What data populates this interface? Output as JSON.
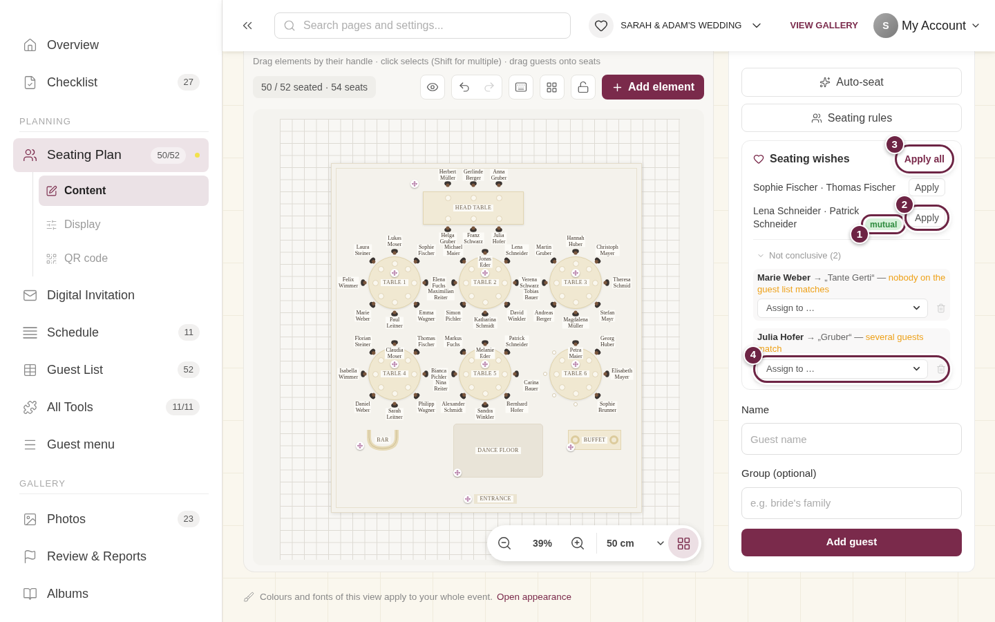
{
  "sidebar": {
    "groups": [
      {
        "items": [
          {
            "label": "Overview",
            "selected": false
          },
          {
            "label": "Checklist",
            "count": "27",
            "selected": false
          }
        ]
      },
      {
        "title": "PLANNING",
        "items": [
          {
            "label": "Seating Plan",
            "count": "50/52",
            "color": "#f2e14c",
            "selected": true,
            "children": [
              {
                "label": "Content",
                "selected": true
              },
              {
                "label": "Display",
                "selected": false
              },
              {
                "label": "QR code",
                "selected": false
              }
            ]
          },
          {
            "label": "Digital Invitation",
            "selected": false
          },
          {
            "label": "Schedule",
            "count": "11",
            "selected": false
          },
          {
            "label": "Guest List",
            "count": "52",
            "selected": false
          },
          {
            "label": "All Tools",
            "count": "11/11",
            "selected": false
          },
          {
            "label": "Guest menu",
            "selected": false
          }
        ]
      },
      {
        "title": "GALLERY",
        "items": [
          {
            "label": "Photos",
            "count": "23",
            "selected": false
          },
          {
            "label": "Review & Reports",
            "selected": false
          },
          {
            "label": "Albums",
            "selected": false
          }
        ]
      }
    ]
  },
  "topbar": {
    "search": {
      "placeholder": "Search pages and settings..."
    },
    "event": {
      "name": "SARAH & ADAM'S WEDDING"
    },
    "gallery_link": "VIEW GALLERY",
    "account": {
      "initial": "S",
      "label": "My Account"
    }
  },
  "seating_plan": {
    "hint": "Drag elements by their handle · click selects (Shift for multiple) · drag guests onto seats",
    "stats": "50 / 52 seated · 54 seats",
    "undo": {
      "disabled": false
    },
    "redo": {
      "disabled": true
    },
    "add_button": "Add element",
    "head_table": {
      "label": "HEAD TABLE",
      "top_seats": [
        {
          "occupied": true,
          "guest": "Herbert Müller"
        },
        {
          "occupied": true,
          "guest": "Gerlinde Berger"
        },
        {
          "occupied": true,
          "guest": "Anna Gruber"
        }
      ],
      "bottom_seats": [
        {
          "occupied": true,
          "guest": "Helga Gruber"
        },
        {
          "occupied": true,
          "guest": "Franz Schwarz"
        },
        {
          "occupied": true,
          "guest": "Julia Hofer"
        }
      ]
    },
    "tables": [
      {
        "label": "TABLE 1",
        "seats": [
          {
            "occupied": true,
            "guest": "Lukas Moser"
          },
          {
            "occupied": true,
            "guest": "Sophie Fischer"
          },
          {
            "occupied": true,
            "guest": "Maximilian Reiter"
          },
          {
            "occupied": true,
            "guest": "Emma Wagner"
          },
          {
            "occupied": true,
            "guest": "Paul Leitner"
          },
          {
            "occupied": true,
            "guest": "Marie Weber"
          },
          {
            "occupied": true,
            "guest": "Felix Wimmer"
          },
          {
            "occupied": true,
            "guest": "Laura Steiner"
          }
        ]
      },
      {
        "label": "TABLE 2",
        "seats": [
          {
            "occupied": true,
            "guest": "Jonas Eder"
          },
          {
            "occupied": true,
            "guest": "Lena Schneider"
          },
          {
            "occupied": true,
            "guest": "Tobias Bauer"
          },
          {
            "occupied": true,
            "guest": "David Winkler"
          },
          {
            "occupied": true,
            "guest": "Katharina Schmidt"
          },
          {
            "occupied": true,
            "guest": "Simon Pichler"
          },
          {
            "occupied": true,
            "guest": "Elena Fuchs"
          },
          {
            "occupied": true,
            "guest": "Michael Maier"
          }
        ]
      },
      {
        "label": "TABLE 3",
        "seats": [
          {
            "occupied": true,
            "guest": "Hannah Huber"
          },
          {
            "occupied": true,
            "guest": "Christoph Mayer"
          },
          {
            "occupied": true,
            "guest": "Theresa Schmid"
          },
          {
            "occupied": true,
            "guest": "Stefan Mayr"
          },
          {
            "occupied": true,
            "guest": "Magdalena Müller"
          },
          {
            "occupied": true,
            "guest": "Andreas Berger"
          },
          {
            "occupied": true,
            "guest": "Verena Schwarz"
          },
          {
            "occupied": true,
            "guest": "Martin Gruber"
          }
        ]
      },
      {
        "label": "TABLE 4",
        "seats": [
          {
            "occupied": true,
            "guest": "Claudia Moser"
          },
          {
            "occupied": true,
            "guest": "Thomas Fischer"
          },
          {
            "occupied": true,
            "guest": "Nina Reiter"
          },
          {
            "occupied": true,
            "guest": "Philipp Wagner"
          },
          {
            "occupied": true,
            "guest": "Sarah Leitner"
          },
          {
            "occupied": true,
            "guest": "Daniel Weber"
          },
          {
            "occupied": true,
            "guest": "Isabella Wimmer"
          },
          {
            "occupied": true,
            "guest": "Florian Steiner"
          }
        ]
      },
      {
        "label": "TABLE 5",
        "seats": [
          {
            "occupied": true,
            "guest": "Melanie Eder"
          },
          {
            "occupied": true,
            "guest": "Patrick Schneider"
          },
          {
            "occupied": true,
            "guest": "Carina Bauer"
          },
          {
            "occupied": true,
            "guest": "Bernhard Hofer"
          },
          {
            "occupied": true,
            "guest": "Sandra Winkler"
          },
          {
            "occupied": true,
            "guest": "Alexander Schmidt"
          },
          {
            "occupied": true,
            "guest": "Bianca Pichler"
          },
          {
            "occupied": true,
            "guest": "Markus Fuchs"
          }
        ]
      },
      {
        "label": "TABLE 6",
        "seats": [
          {
            "occupied": true,
            "guest": "Petra Maier"
          },
          {
            "occupied": true,
            "guest": "Georg Huber"
          },
          {
            "occupied": true,
            "guest": "Elisabeth Mayer"
          },
          {
            "occupied": true,
            "guest": "Sophie Brunner"
          },
          {
            "occupied": false
          },
          {
            "occupied": false
          },
          {
            "occupied": false
          },
          {
            "occupied": false
          }
        ]
      }
    ],
    "areas": [
      {
        "kind": "bar",
        "label": "BAR"
      },
      {
        "kind": "dance_floor",
        "label": "DANCE FLOOR"
      },
      {
        "kind": "buffet",
        "label": "BUFFET"
      },
      {
        "kind": "entrance",
        "label": "ENTRANCE"
      }
    ],
    "zoom_bar": {
      "zoom": "39%",
      "grid_size": "50 cm",
      "grid_on": true
    }
  },
  "guests_panel": {
    "auto_seat": "Auto-seat",
    "rules": "Seating rules",
    "wishes": {
      "title": "Seating wishes",
      "apply_all": {
        "label": "Apply all",
        "callout": "3"
      },
      "pairs": [
        {
          "names": "Sophie Fischer · Thomas Fischer",
          "apply": {
            "label": "Apply"
          }
        },
        {
          "names": "Lena Schneider · Patrick Schneider",
          "badge": {
            "label": "mutual",
            "callout": "1"
          },
          "apply": {
            "label": "Apply",
            "callout": "2"
          }
        }
      ],
      "unresolved": {
        "label": "Not conclusive (2)",
        "expanded": true,
        "items": [
          {
            "guest": "Marie Weber",
            "wish": "→ „Tante Gerti“ —",
            "problem": "nobody on the guest list matches",
            "select": {
              "value": "Assign to …"
            }
          },
          {
            "guest": "Julia Hofer",
            "wish": "→ „Gruber“ —",
            "problem": "several guests match",
            "select": {
              "value": "Assign to …",
              "callout": "4"
            }
          }
        ]
      }
    },
    "form": {
      "fields": [
        {
          "label": "Name",
          "placeholder": "Guest name"
        },
        {
          "label": "Group (optional)",
          "placeholder": "e.g. bride's family"
        }
      ],
      "submit": "Add guest"
    }
  },
  "footer": {
    "note": "Colours and fonts of this view apply to your whole event.",
    "link": "Open appearance"
  }
}
